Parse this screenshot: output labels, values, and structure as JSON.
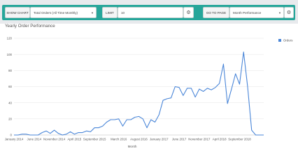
{
  "toolbar": {
    "show_chart_label": "SHOW CHART",
    "show_chart_value": "Total Orders (All Time Monthly)",
    "limit_label": "LIMIT",
    "limit_value": "10",
    "go_to_page_label": "GO TO PAGE",
    "go_to_page_value": "Month Performance",
    "settings_icon": "gear-icon",
    "dropdown_icon": "caret-down-icon"
  },
  "colors": {
    "toolbar_accent": "#26a69a",
    "series_line": "#4a86d8"
  },
  "chart_data": {
    "type": "line",
    "title": "Yearly Order Performance",
    "xlabel": "Month",
    "ylabel": "",
    "ylim": [
      0,
      120
    ],
    "yticks": [
      0,
      20,
      40,
      60,
      80,
      100,
      120
    ],
    "grid": true,
    "legend": "top-right",
    "x_tick_labels": [
      {
        "index": 0,
        "label": "January 2014"
      },
      {
        "index": 5,
        "label": "June 2014"
      },
      {
        "index": 10,
        "label": "November 2014"
      },
      {
        "index": 15,
        "label": "April 2015"
      },
      {
        "index": 20,
        "label": "September 2015"
      },
      {
        "index": 26,
        "label": "March 2016"
      },
      {
        "index": 31,
        "label": "August 2016"
      },
      {
        "index": 36,
        "label": "January 2017"
      },
      {
        "index": 41,
        "label": "June 2017"
      },
      {
        "index": 46,
        "label": "November 2017"
      },
      {
        "index": 51,
        "label": "April 2018"
      },
      {
        "index": 56,
        "label": "September 2018"
      }
    ],
    "series": [
      {
        "name": "Orders",
        "values": [
          0,
          0,
          1,
          1,
          0,
          0,
          0,
          3,
          5,
          2,
          6,
          2,
          0,
          1,
          4,
          1,
          3,
          3,
          5,
          4,
          9,
          9,
          11,
          16,
          19,
          19,
          20,
          11,
          19,
          19,
          22,
          23,
          20,
          9,
          19,
          16,
          25,
          43,
          45,
          46,
          60,
          59,
          49,
          58,
          58,
          47,
          57,
          54,
          58,
          56,
          59,
          64,
          88,
          39,
          57,
          76,
          63,
          103,
          60,
          6,
          0,
          0,
          0
        ]
      }
    ]
  }
}
